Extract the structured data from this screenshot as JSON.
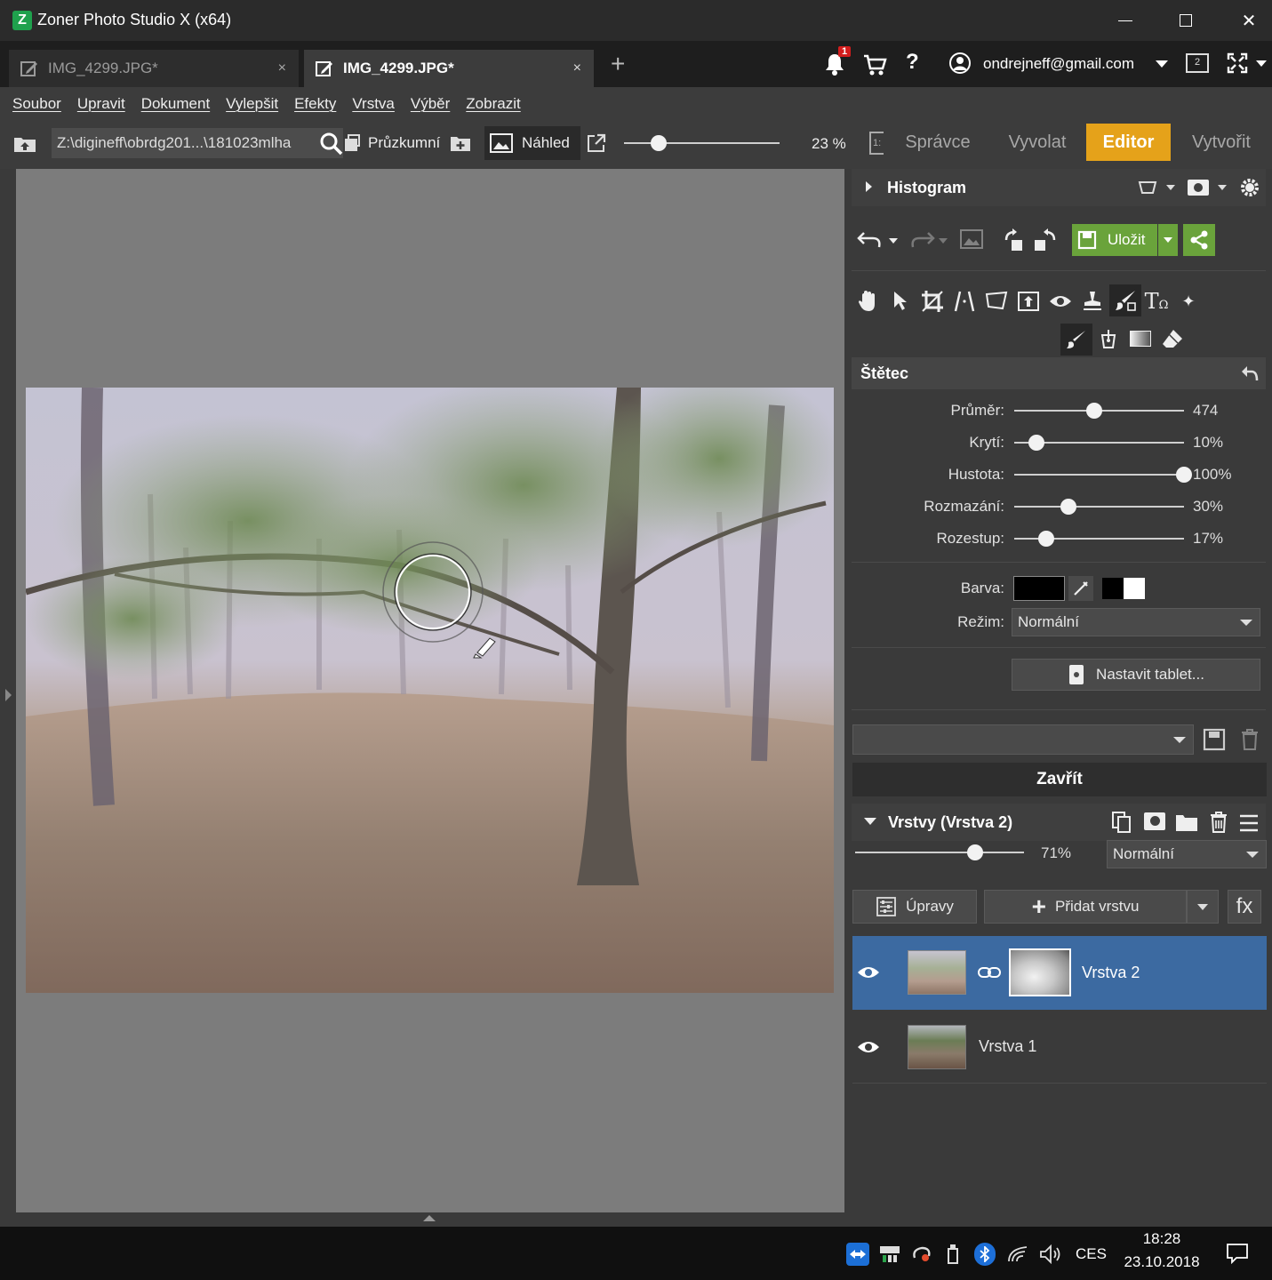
{
  "window": {
    "title": "Zoner Photo Studio X (x64)",
    "minimize": "—",
    "maximize": "☐",
    "close": "✕"
  },
  "tabs": [
    {
      "label": "IMG_4299.JPG*",
      "close": "×",
      "active": false
    },
    {
      "label": "IMG_4299.JPG*",
      "close": "×",
      "active": true
    }
  ],
  "topright": {
    "new_tab": "+",
    "notification_count": "1",
    "help": "?",
    "account": "ondrejneff@gmail.com",
    "monitor_number": "2"
  },
  "menu": [
    "Soubor",
    "Upravit",
    "Dokument",
    "Vylepšit",
    "Efekty",
    "Vrstva",
    "Výběr",
    "Zobrazit"
  ],
  "toolbar": {
    "path": "Z:\\digineff\\obrdg201...\\181023mlha",
    "explorer": "Průzkumní",
    "preview": "Náhled",
    "zoom_value": "23 %",
    "zoom_fraction": 0.22
  },
  "modes": [
    {
      "label": "Správce",
      "active": false
    },
    {
      "label": "Vyvolat",
      "active": false
    },
    {
      "label": "Editor",
      "active": true
    },
    {
      "label": "Vytvořit",
      "active": false
    }
  ],
  "colors": {
    "accent": "#e5a21a",
    "save_green": "#6aa33b",
    "selected_layer": "#3c6aa1"
  },
  "histogram": {
    "title": "Histogram"
  },
  "actions": {
    "save": "Uložit"
  },
  "brush": {
    "title": "Štětec",
    "sliders": [
      {
        "label": "Průměr:",
        "value": "474",
        "fraction": 0.47
      },
      {
        "label": "Krytí:",
        "value": "10%",
        "fraction": 0.13
      },
      {
        "label": "Hustota:",
        "value": "100%",
        "fraction": 1.0
      },
      {
        "label": "Rozmazání:",
        "value": "30%",
        "fraction": 0.32
      },
      {
        "label": "Rozestup:",
        "value": "17%",
        "fraction": 0.19
      }
    ],
    "color_label": "Barva:",
    "mode_label": "Režim:",
    "mode_value": "Normální",
    "tablet_button": "Nastavit tablet...",
    "preset_value": "",
    "close_button": "Zavřít"
  },
  "layers": {
    "title": "Vrstvy (Vrstva 2)",
    "opacity_value": "71%",
    "opacity_fraction": 0.71,
    "blend_mode": "Normální",
    "adjust_button": "Úpravy",
    "add_layer_button": "Přidat vrstvu",
    "fx_button": "fx",
    "items": [
      {
        "name": "Vrstva 2",
        "selected": true
      },
      {
        "name": "Vrstva 1",
        "selected": false
      }
    ]
  },
  "taskbar": {
    "language": "CES",
    "time": "18:28",
    "date": "23.10.2018"
  }
}
